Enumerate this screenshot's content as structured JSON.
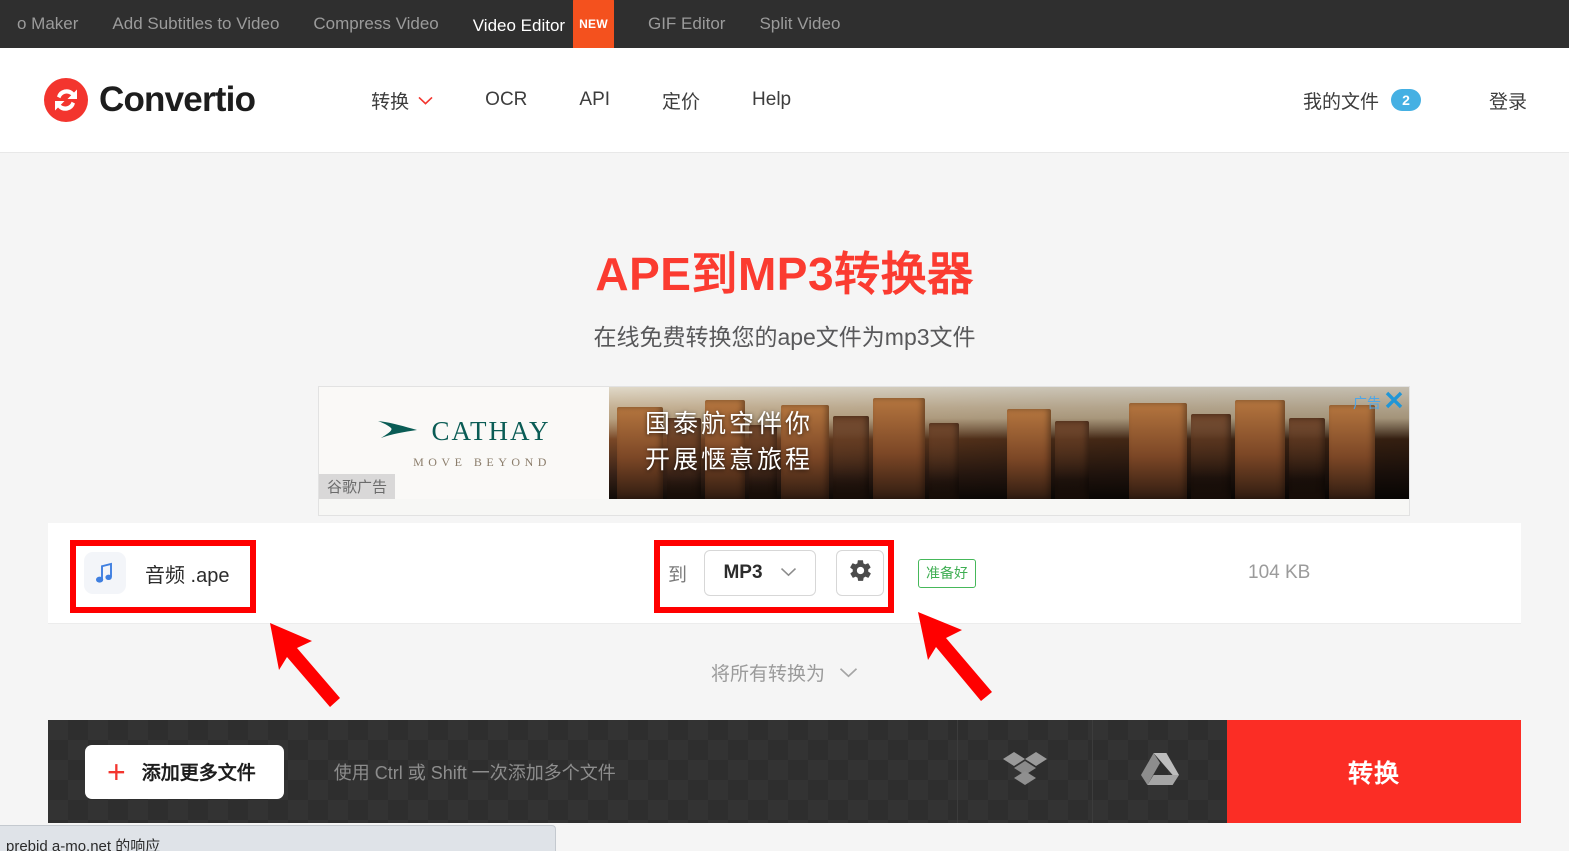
{
  "topbar": {
    "items": [
      {
        "label": "o Maker",
        "active": false,
        "badge": null
      },
      {
        "label": "Add Subtitles to Video",
        "active": false,
        "badge": null
      },
      {
        "label": "Compress Video",
        "active": false,
        "badge": null
      },
      {
        "label": "Video Editor",
        "active": true,
        "badge": "NEW"
      },
      {
        "label": "GIF Editor",
        "active": false,
        "badge": null
      },
      {
        "label": "Split Video",
        "active": false,
        "badge": null
      }
    ]
  },
  "header": {
    "logo_text": "Convertio",
    "nav": [
      {
        "label": "转换",
        "has_chevron": true
      },
      {
        "label": "OCR",
        "has_chevron": false
      },
      {
        "label": "API",
        "has_chevron": false
      },
      {
        "label": "定价",
        "has_chevron": false
      },
      {
        "label": "Help",
        "has_chevron": false
      }
    ],
    "my_files_label": "我的文件",
    "my_files_count": "2",
    "login_label": "登录"
  },
  "hero": {
    "title": "APE到MP3转换器",
    "subtitle": "在线免费转换您的ape文件为mp3文件"
  },
  "ad": {
    "brand_name": "CATHAY",
    "brand_tagline": "MOVE BEYOND",
    "headline_line1": "国泰航空伴你",
    "headline_line2": "开展惬意旅程",
    "provider_label": "谷歌广告",
    "close_label": "广告"
  },
  "file_row": {
    "file_name": "音频 .ape",
    "to_label": "到",
    "format": "MP3",
    "status_badge": "准备好",
    "file_size": "104 KB"
  },
  "convert_all": {
    "label": "将所有转换为"
  },
  "action_bar": {
    "add_more_label": "添加更多文件",
    "hint": "使用 Ctrl 或 Shift 一次添加多个文件",
    "convert_label": "转换",
    "dropbox_icon": "dropbox-icon",
    "google_drive_icon": "google-drive-icon"
  },
  "statusbar": {
    "text": "prebid a-mo.net 的响应"
  },
  "colors": {
    "brand_red": "#f3352e",
    "title_red": "#fb3b30",
    "convert_red": "#fb2d25",
    "badge_blue": "#45b0e3",
    "ready_green": "#3fae52",
    "new_orange": "#f4511e",
    "annotation_red": "#ff0000",
    "topbar_bg": "#2f2f2f",
    "action_bar_bg": "#333333"
  }
}
